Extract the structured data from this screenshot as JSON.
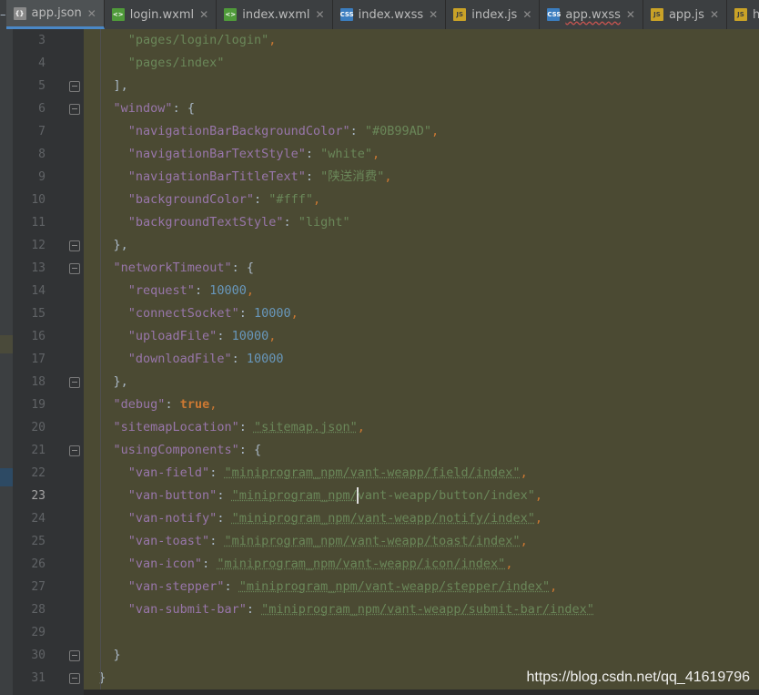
{
  "tabs": [
    {
      "name": "app.json",
      "icon": "json-file-icon",
      "active": true,
      "squiggle": false
    },
    {
      "name": "login.wxml",
      "icon": "wxml-file-icon",
      "active": false,
      "squiggle": false
    },
    {
      "name": "index.wxml",
      "icon": "wxml-file-icon",
      "active": false,
      "squiggle": false
    },
    {
      "name": "index.wxss",
      "icon": "wxss-file-icon",
      "active": false,
      "squiggle": false
    },
    {
      "name": "index.js",
      "icon": "js-file-icon",
      "active": false,
      "squiggle": false
    },
    {
      "name": "app.wxss",
      "icon": "wxss-file-icon",
      "active": false,
      "squiggle": true
    },
    {
      "name": "app.js",
      "icon": "js-file-icon",
      "active": false,
      "squiggle": false
    },
    {
      "name": "http.js",
      "icon": "js-file-icon",
      "active": false,
      "squiggle": false
    }
  ],
  "tab_bar_left_glyph": "–",
  "current_line": 23,
  "lines": [
    {
      "num": "3",
      "tokens": [
        {
          "t": "    "
        },
        {
          "c": "s",
          "t": "\"pages/login/login\""
        },
        {
          "c": "p",
          "t": ","
        }
      ]
    },
    {
      "num": "4",
      "tokens": [
        {
          "t": "    "
        },
        {
          "c": "s",
          "t": "\"pages/index\""
        }
      ]
    },
    {
      "num": "5",
      "tokens": [
        {
          "t": "  "
        },
        {
          "t": "],"
        }
      ]
    },
    {
      "num": "6",
      "tokens": [
        {
          "t": "  "
        },
        {
          "c": "k",
          "t": "\"window\""
        },
        {
          "t": ": {"
        }
      ]
    },
    {
      "num": "7",
      "tokens": [
        {
          "t": "    "
        },
        {
          "c": "k",
          "t": "\"navigationBarBackgroundColor\""
        },
        {
          "t": ": "
        },
        {
          "c": "s",
          "t": "\"#0B99AD\""
        },
        {
          "c": "p",
          "t": ","
        }
      ]
    },
    {
      "num": "8",
      "tokens": [
        {
          "t": "    "
        },
        {
          "c": "k",
          "t": "\"navigationBarTextStyle\""
        },
        {
          "t": ": "
        },
        {
          "c": "s",
          "t": "\"white\""
        },
        {
          "c": "p",
          "t": ","
        }
      ]
    },
    {
      "num": "9",
      "tokens": [
        {
          "t": "    "
        },
        {
          "c": "k",
          "t": "\"navigationBarTitleText\""
        },
        {
          "t": ": "
        },
        {
          "c": "s",
          "t": "\"陕送消费\""
        },
        {
          "c": "p",
          "t": ","
        }
      ]
    },
    {
      "num": "10",
      "tokens": [
        {
          "t": "    "
        },
        {
          "c": "k",
          "t": "\"backgroundColor\""
        },
        {
          "t": ": "
        },
        {
          "c": "s",
          "t": "\"#fff\""
        },
        {
          "c": "p",
          "t": ","
        }
      ]
    },
    {
      "num": "11",
      "tokens": [
        {
          "t": "    "
        },
        {
          "c": "k",
          "t": "\"backgroundTextStyle\""
        },
        {
          "t": ": "
        },
        {
          "c": "s",
          "t": "\"light\""
        }
      ]
    },
    {
      "num": "12",
      "tokens": [
        {
          "t": "  "
        },
        {
          "t": "},"
        }
      ]
    },
    {
      "num": "13",
      "tokens": [
        {
          "t": "  "
        },
        {
          "c": "k",
          "t": "\"networkTimeout\""
        },
        {
          "t": ": {"
        }
      ]
    },
    {
      "num": "14",
      "tokens": [
        {
          "t": "    "
        },
        {
          "c": "k",
          "t": "\"request\""
        },
        {
          "t": ": "
        },
        {
          "c": "n",
          "t": "10000"
        },
        {
          "c": "p",
          "t": ","
        }
      ]
    },
    {
      "num": "15",
      "tokens": [
        {
          "t": "    "
        },
        {
          "c": "k",
          "t": "\"connectSocket\""
        },
        {
          "t": ": "
        },
        {
          "c": "n",
          "t": "10000"
        },
        {
          "c": "p",
          "t": ","
        }
      ]
    },
    {
      "num": "16",
      "tokens": [
        {
          "t": "    "
        },
        {
          "c": "k",
          "t": "\"uploadFile\""
        },
        {
          "t": ": "
        },
        {
          "c": "n",
          "t": "10000"
        },
        {
          "c": "p",
          "t": ","
        }
      ]
    },
    {
      "num": "17",
      "tokens": [
        {
          "t": "    "
        },
        {
          "c": "k",
          "t": "\"downloadFile\""
        },
        {
          "t": ": "
        },
        {
          "c": "n",
          "t": "10000"
        }
      ]
    },
    {
      "num": "18",
      "tokens": [
        {
          "t": "  "
        },
        {
          "t": "},"
        }
      ]
    },
    {
      "num": "19",
      "tokens": [
        {
          "t": "  "
        },
        {
          "c": "k",
          "t": "\"debug\""
        },
        {
          "t": ": "
        },
        {
          "c": "kw",
          "t": "true"
        },
        {
          "c": "p",
          "t": ","
        }
      ]
    },
    {
      "num": "20",
      "tokens": [
        {
          "t": "  "
        },
        {
          "c": "k",
          "t": "\"sitemapLocation\""
        },
        {
          "t": ": "
        },
        {
          "c": "s",
          "t": "\"sitemap.json\""
        },
        {
          "c": "p",
          "t": ","
        }
      ]
    },
    {
      "num": "21",
      "tokens": [
        {
          "t": "  "
        },
        {
          "c": "k",
          "t": "\"usingComponents\""
        },
        {
          "t": ": {"
        }
      ]
    },
    {
      "num": "22",
      "tokens": [
        {
          "t": "    "
        },
        {
          "c": "k",
          "t": "\"van-field\""
        },
        {
          "t": ": "
        },
        {
          "c": "s",
          "t": "\"miniprogram_npm/vant-weapp/field/index\""
        },
        {
          "c": "p",
          "t": ","
        }
      ]
    },
    {
      "num": "23",
      "tokens": [
        {
          "t": "    "
        },
        {
          "c": "k",
          "t": "\"van-button\""
        },
        {
          "t": ": "
        },
        {
          "c": "s",
          "t": "\"miniprogram_npm/"
        },
        {
          "caret": true
        },
        {
          "c": "s",
          "t": "vant-weapp/button/index\""
        },
        {
          "c": "p",
          "t": ","
        }
      ]
    },
    {
      "num": "24",
      "tokens": [
        {
          "t": "    "
        },
        {
          "c": "k",
          "t": "\"van-notify\""
        },
        {
          "t": ": "
        },
        {
          "c": "s",
          "t": "\"miniprogram_npm/vant-weapp/notify/index\""
        },
        {
          "c": "p",
          "t": ","
        }
      ]
    },
    {
      "num": "25",
      "tokens": [
        {
          "t": "    "
        },
        {
          "c": "k",
          "t": "\"van-toast\""
        },
        {
          "t": ": "
        },
        {
          "c": "s",
          "t": "\"miniprogram_npm/vant-weapp/toast/index\""
        },
        {
          "c": "p",
          "t": ","
        }
      ]
    },
    {
      "num": "26",
      "tokens": [
        {
          "t": "    "
        },
        {
          "c": "k",
          "t": "\"van-icon\""
        },
        {
          "t": ": "
        },
        {
          "c": "s",
          "t": "\"miniprogram_npm/vant-weapp/icon/index\""
        },
        {
          "c": "p",
          "t": ","
        }
      ]
    },
    {
      "num": "27",
      "tokens": [
        {
          "t": "    "
        },
        {
          "c": "k",
          "t": "\"van-stepper\""
        },
        {
          "t": ": "
        },
        {
          "c": "s",
          "t": "\"miniprogram_npm/vant-weapp/stepper/index\""
        },
        {
          "c": "p",
          "t": ","
        }
      ]
    },
    {
      "num": "28",
      "tokens": [
        {
          "t": "    "
        },
        {
          "c": "k",
          "t": "\"van-submit-bar\""
        },
        {
          "t": ": "
        },
        {
          "c": "s",
          "t": "\"miniprogram_npm/vant-weapp/submit-bar/index\""
        }
      ]
    },
    {
      "num": "29",
      "tokens": []
    },
    {
      "num": "30",
      "tokens": [
        {
          "t": "  "
        },
        {
          "t": "}"
        }
      ]
    },
    {
      "num": "31",
      "tokens": [
        {
          "t": "}"
        }
      ]
    }
  ],
  "fold_markers": [
    "5",
    "6",
    "12",
    "13",
    "18",
    "21",
    "30",
    "31"
  ],
  "intention_bulb_line": "23",
  "watermark": "https://blog.csdn.net/qq_41619796"
}
